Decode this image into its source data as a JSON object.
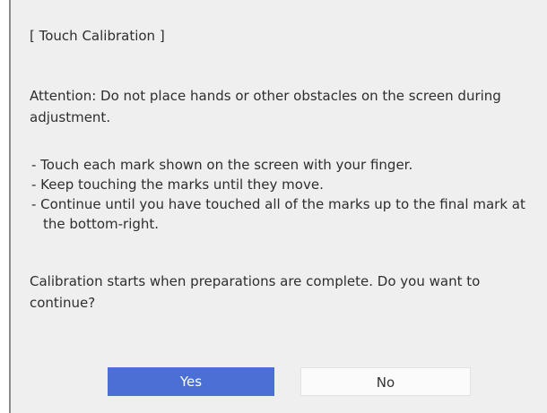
{
  "dialog": {
    "title": "[ Touch Calibration ]",
    "attention": "Attention: Do not place hands or other obstacles on the screen during adjustment.",
    "instructions": [
      "- Touch each mark shown on the screen with your finger.",
      "- Keep touching the marks until they move.",
      "- Continue until you have touched all of the marks up to the final mark at the bottom-right."
    ],
    "confirm": "Calibration starts when preparations are complete. Do you want to continue?",
    "buttons": {
      "yes": "Yes",
      "no": "No"
    },
    "colors": {
      "background": "#efefef",
      "yes_button": "#4c6fd6",
      "no_button": "#fbfbfb"
    }
  }
}
